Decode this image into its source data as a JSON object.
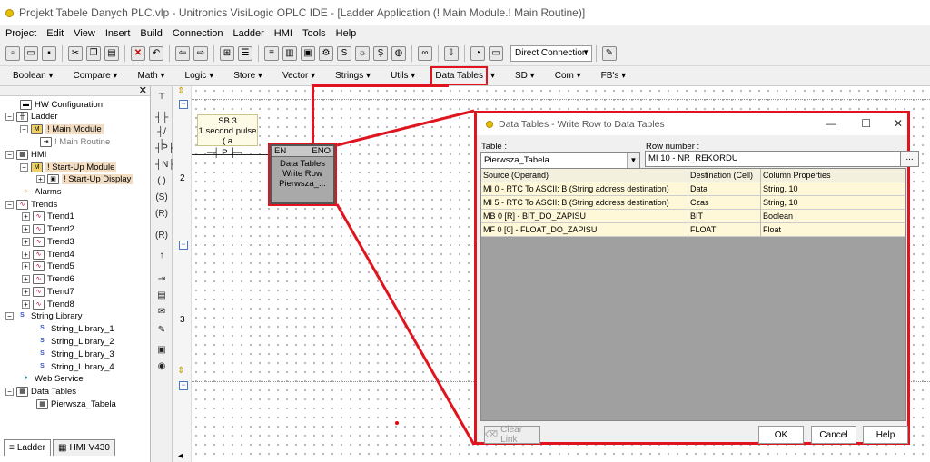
{
  "window": {
    "title": "Projekt Tabele Danych PLC.vlp - Unitronics VisiLogic OPLC IDE - [Ladder Application (! Main Module.! Main Routine)]"
  },
  "menu": [
    "Project",
    "Edit",
    "View",
    "Insert",
    "Build",
    "Connection",
    "Ladder",
    "HMI",
    "Tools",
    "Help"
  ],
  "toolbar": {
    "connection_select": "Direct Connection"
  },
  "ladder_toolbar": [
    "Boolean",
    "Compare",
    "Math",
    "Logic",
    "Store",
    "Vector",
    "Strings",
    "Utils",
    "Data Tables",
    "SD",
    "Com",
    "FB's"
  ],
  "tree": [
    {
      "label": "HW Configuration",
      "icon": "hw-config-icon"
    },
    {
      "label": "Ladder",
      "icon": "ladder-icon"
    },
    {
      "label": "! Main Module",
      "icon": "module-icon"
    },
    {
      "label": "! Main Routine",
      "icon": "routine-icon"
    },
    {
      "label": "HMI",
      "icon": "hmi-icon"
    },
    {
      "label": "! Start-Up Module",
      "icon": "module-icon"
    },
    {
      "label": "! Start-Up Display",
      "icon": "display-icon"
    },
    {
      "label": "Alarms",
      "icon": "alarm-icon"
    },
    {
      "label": "Trends",
      "icon": "trend-icon"
    },
    {
      "label": "Trend1",
      "icon": "trend-icon"
    },
    {
      "label": "Trend2",
      "icon": "trend-icon"
    },
    {
      "label": "Trend3",
      "icon": "trend-icon"
    },
    {
      "label": "Trend4",
      "icon": "trend-icon"
    },
    {
      "label": "Trend5",
      "icon": "trend-icon"
    },
    {
      "label": "Trend6",
      "icon": "trend-icon"
    },
    {
      "label": "Trend7",
      "icon": "trend-icon"
    },
    {
      "label": "Trend8",
      "icon": "trend-icon"
    },
    {
      "label": "String Library",
      "icon": "string-icon"
    },
    {
      "label": "String_Library_1",
      "icon": "string-icon"
    },
    {
      "label": "String_Library_2",
      "icon": "string-icon"
    },
    {
      "label": "String_Library_3",
      "icon": "string-icon"
    },
    {
      "label": "String_Library_4",
      "icon": "string-icon"
    },
    {
      "label": "Web Service",
      "icon": "web-icon"
    },
    {
      "label": "Data Tables",
      "icon": "datatable-icon"
    },
    {
      "label": "Pierwsza_Tabela",
      "icon": "table-icon"
    }
  ],
  "bottom_tabs": [
    "Ladder",
    "HMI V430"
  ],
  "rungs": [
    "2",
    "3"
  ],
  "rung1": {
    "contact_label": "SB 3\n1 second pulse\n( a",
    "contact_type": "P",
    "block": {
      "en": "EN",
      "eno": "ENO",
      "line1": "Data Tables",
      "line2": "Write Row",
      "line3": "Pierwsza_..."
    }
  },
  "dialog": {
    "title": "Data Tables - Write Row to Data Tables",
    "table_label": "Table :",
    "table_value": "Pierwsza_Tabela",
    "row_label": "Row number :",
    "row_value": "MI 10  - NR_REKORDU",
    "browse": "...",
    "columns": [
      "Source (Operand)",
      "Destination (Cell)",
      "Column Properties"
    ],
    "rows": [
      [
        "MI 0  - RTC To ASCII: B (String address destination)",
        "Data",
        "String, 10"
      ],
      [
        "MI 5  - RTC To ASCII: B (String address destination)",
        "Czas",
        "String, 10"
      ],
      [
        "MB 0 [R] - BIT_DO_ZAPISU",
        "BIT",
        "Boolean"
      ],
      [
        "MF 0 [0] - FLOAT_DO_ZAPISU",
        "FLOAT",
        "Float"
      ]
    ],
    "clear_link": "Clear Link",
    "ok": "OK",
    "cancel": "Cancel",
    "help": "Help"
  },
  "colors": {
    "highlight": "#e0141e",
    "selected_tree": "#f2dcc2",
    "grid_row": "#fff8d8"
  }
}
